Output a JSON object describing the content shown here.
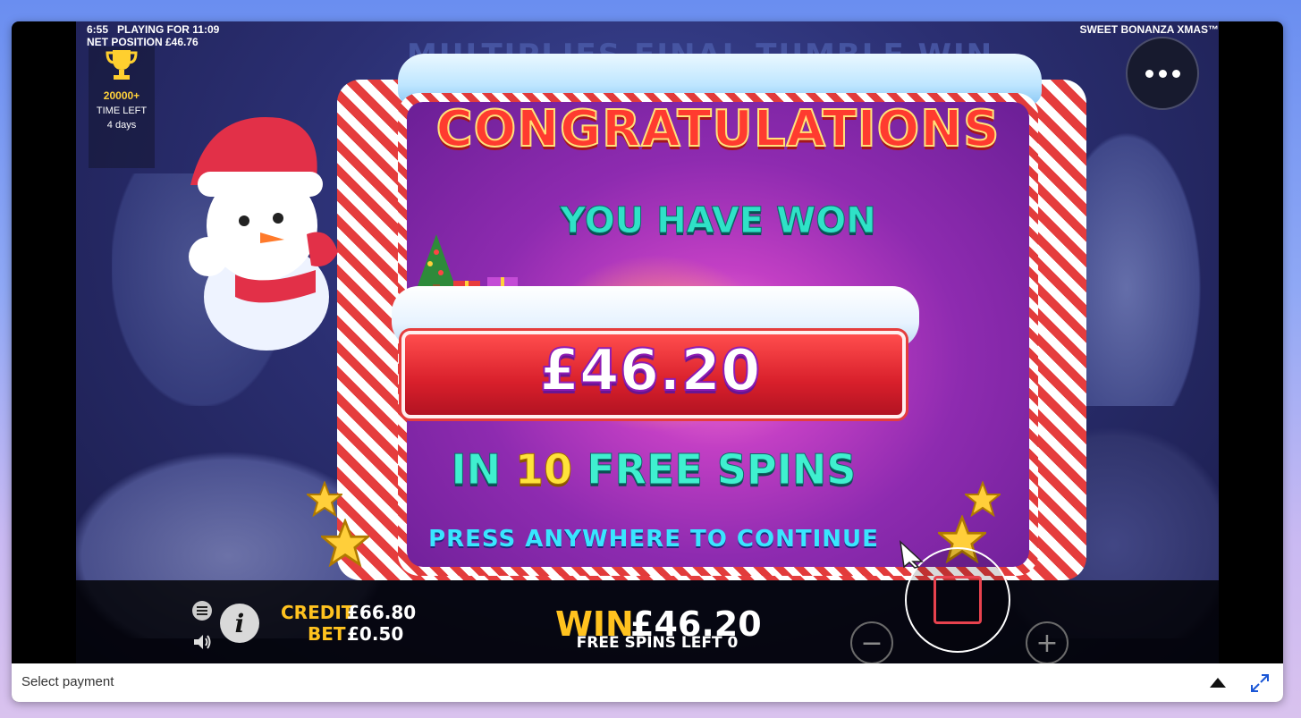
{
  "status": {
    "time": "6:55",
    "playing_for": "PLAYING FOR 11:09",
    "net_position": "NET POSITION £46.76"
  },
  "promo": {
    "icon": "trophy-icon",
    "amount": "20000+",
    "label": "TIME LEFT",
    "days": "4 days"
  },
  "game": {
    "name": "SWEET BONANZA XMAS™",
    "background_banner": "MULTIPLIES FINAL TUMBLE WIN"
  },
  "popup": {
    "title": "CONGRATULATIONS",
    "subtitle": "YOU HAVE WON",
    "amount": "£46.20",
    "in_label": "IN",
    "spins_count": "10",
    "spins_label": "FREE SPINS",
    "prompt": "PRESS ANYWHERE TO CONTINUE"
  },
  "bottom_bar": {
    "credit_label": "CREDIT",
    "credit_value": "£66.80",
    "bet_label": "BET",
    "bet_value": "£0.50",
    "win_label": "WIN",
    "win_value": "£46.20",
    "spins_left_text": "FREE SPINS LEFT 0",
    "minus_symbol": "−",
    "plus_symbol": "+"
  },
  "footer": {
    "select_payment": "Select payment"
  },
  "colors": {
    "accent_gold": "#ffc21f",
    "title_red": "#ff3b2f",
    "teal": "#2fe2c7",
    "stop_red": "#e8424e"
  }
}
